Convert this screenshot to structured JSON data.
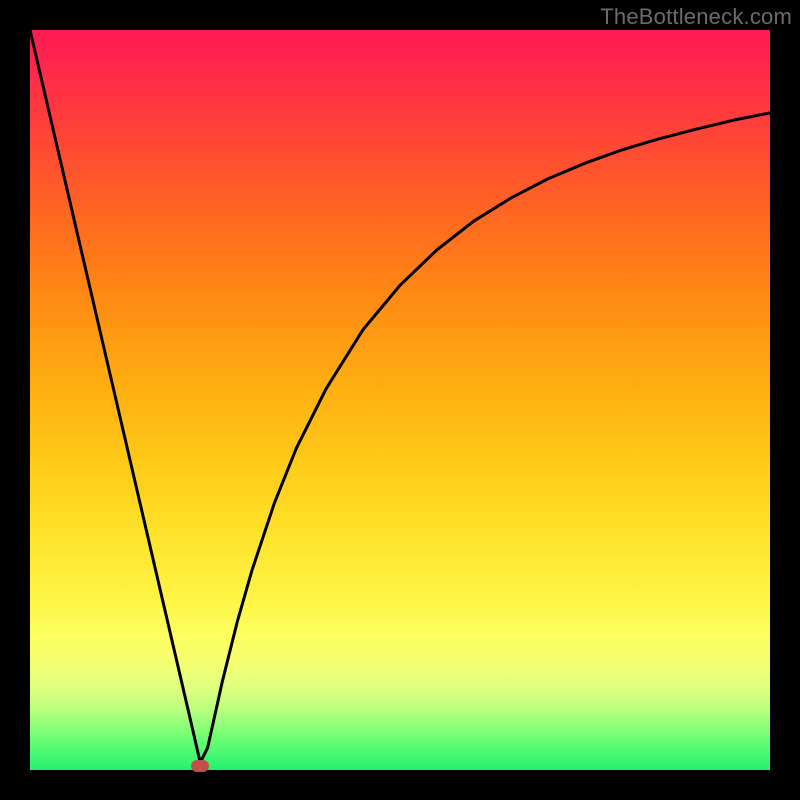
{
  "watermark": "TheBottleneck.com",
  "colors": {
    "frame": "#000000",
    "curve": "#000000",
    "marker": "#c24d4d"
  },
  "chart_data": {
    "type": "line",
    "title": "",
    "xlabel": "",
    "ylabel": "",
    "xlim": [
      0,
      100
    ],
    "ylim": [
      0,
      100
    ],
    "grid": false,
    "legend": false,
    "annotations": [
      "TheBottleneck.com"
    ],
    "series": [
      {
        "name": "bottleneck-curve",
        "x": [
          0,
          2,
          4,
          6,
          8,
          10,
          12,
          14,
          16,
          18,
          20,
          22,
          23,
          24,
          26,
          28,
          30,
          33,
          36,
          40,
          45,
          50,
          55,
          60,
          65,
          70,
          75,
          80,
          85,
          90,
          95,
          100
        ],
        "y": [
          100,
          91.4,
          82.8,
          74.2,
          65.6,
          57.0,
          48.4,
          39.8,
          31.2,
          22.6,
          14.0,
          5.4,
          1.0,
          3.0,
          12.0,
          20.0,
          27.0,
          36.0,
          43.5,
          51.5,
          59.5,
          65.5,
          70.3,
          74.2,
          77.3,
          79.9,
          82.0,
          83.8,
          85.3,
          86.6,
          87.8,
          88.8
        ]
      }
    ],
    "marker": {
      "x": 23,
      "y": 0.5
    },
    "background_gradient": {
      "top": "#ff1a55",
      "bottom": "#23f26e",
      "note": "red (high bottleneck) at top to green (no bottleneck) at bottom"
    }
  }
}
